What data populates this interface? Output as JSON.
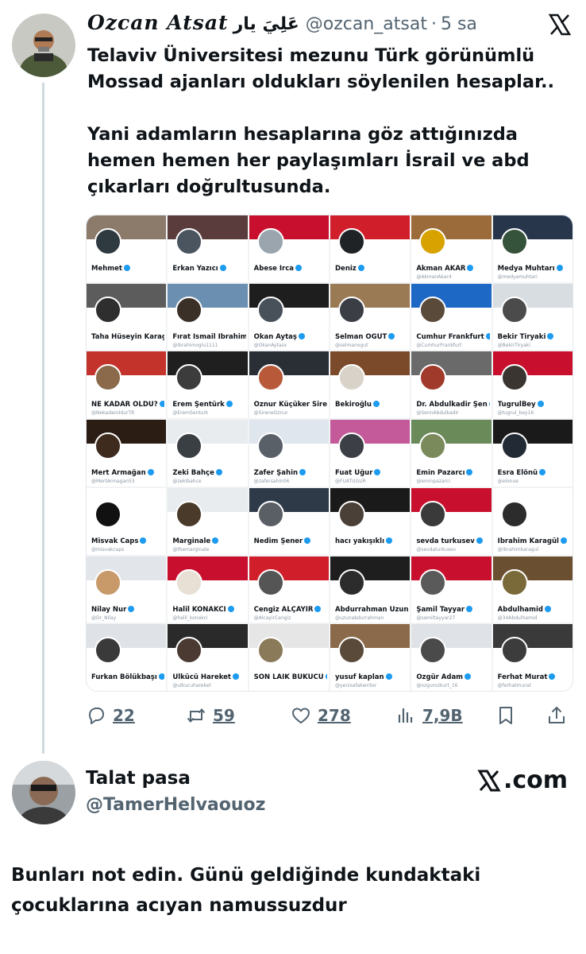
{
  "tweet": {
    "author_name": "Ozcan Atsat",
    "author_rtl": "عَلِيَ يار",
    "handle": "@ozcan_atsat",
    "dot": "·",
    "time": "5 sa",
    "text": "Telaviv Üniversitesi mezunu Türk görünümlü\nMossad ajanları oldukları söylenilen hesaplar..\n\nYani adamların hesaplarına göz attığınızda\nhemen hemen her paylaşımları İsrail ve abd\nçıkarları doğrultusunda.",
    "metrics": {
      "replies": "22",
      "reposts": "59",
      "likes": "278",
      "views": "7,9B"
    },
    "icons": [
      "x-logo-icon",
      "reply-icon",
      "repost-icon",
      "like-icon",
      "views-icon",
      "bookmark-icon",
      "share-icon"
    ]
  },
  "media_accounts": [
    {
      "name": "Mehmet",
      "handle": "",
      "banner": "#8c7a6b",
      "avatar": "#2f3a40"
    },
    {
      "name": "Erkan Yazıcı",
      "handle": "",
      "banner": "#5a3c3c",
      "avatar": "#4a5560"
    },
    {
      "name": "Abese İrca",
      "handle": "",
      "banner": "#c8102e",
      "avatar": "#9aa5ad"
    },
    {
      "name": "Deniz",
      "handle": "",
      "banner": "#d01e2a",
      "avatar": "#1f2326"
    },
    {
      "name": "Akman AKAR",
      "handle": "@AkmanAkar4",
      "banner": "#9c6b3a",
      "avatar": "#d8a200"
    },
    {
      "name": "Medya Muhtarı",
      "handle": "@medyamuhtari",
      "banner": "#27364a",
      "avatar": "#35523b"
    },
    {
      "name": "Taha Hüseyin Karagöz",
      "handle": "",
      "banner": "#5c5c5c",
      "avatar": "#2e2e2e"
    },
    {
      "name": "Fırat İsmail İbrahimoğlu",
      "handle": "@ibrahimoglu1111",
      "banner": "#6b8fb0",
      "avatar": "#3a3028"
    },
    {
      "name": "Okan Aytaş",
      "handle": "@OkanAytasx",
      "banner": "#1e1e1e",
      "avatar": "#48505a"
    },
    {
      "name": "Selman ÖĞÜT",
      "handle": "@selmanogut",
      "banner": "#9a7a55",
      "avatar": "#3b3f45"
    },
    {
      "name": "Cumhur Frankfurt",
      "handle": "@CumhurFrankfurt",
      "banner": "#1d68c4",
      "avatar": "#5a4a3a"
    },
    {
      "name": "Bekir Tiryaki",
      "handle": "@BekirTiryaki",
      "banner": "#d8dde2",
      "avatar": "#4b4b4b"
    },
    {
      "name": "NE KADAR OLDU?",
      "handle": "@NekadaroldurTR",
      "banner": "#c4332b",
      "avatar": "#8a6a4a"
    },
    {
      "name": "Erem Şentürk",
      "handle": "@EremSenturk",
      "banner": "#1f1f1f",
      "avatar": "#3c3c3c"
    },
    {
      "name": "Öznur Küçüker Sirene",
      "handle": "@SireneOznur",
      "banner": "#2a2f36",
      "avatar": "#b85a3a"
    },
    {
      "name": "Bekiroğlu",
      "handle": "",
      "banner": "#7a4a2a",
      "avatar": "#d9d2c8"
    },
    {
      "name": "Dr. Abdulkadir Şen",
      "handle": "@SennAbdulkadir",
      "banner": "#6a6a6a",
      "avatar": "#a03a2a"
    },
    {
      "name": "TugrulBey",
      "handle": "@tugrul_bey16",
      "banner": "#c8102e",
      "avatar": "#3a3530"
    },
    {
      "name": "Mert Armağan",
      "handle": "@MertArmagan53",
      "banner": "#2b1c14",
      "avatar": "#3e2b1e"
    },
    {
      "name": "Zeki Bahçe",
      "handle": "@zekibahce",
      "banner": "#e8ecef",
      "avatar": "#3a3f44"
    },
    {
      "name": "Zafer Şahin",
      "handle": "@zafersahin06",
      "banner": "#dfe6ee",
      "avatar": "#5a6068"
    },
    {
      "name": "Fuat Uğur",
      "handle": "@FUATUGUR",
      "banner": "#c45a9a",
      "avatar": "#3c3f45"
    },
    {
      "name": "Emin Pazarcı",
      "handle": "@eminpazarci",
      "banner": "#6b8a5a",
      "avatar": "#7a8a5a"
    },
    {
      "name": "Esra Elönü",
      "handle": "@elonue",
      "banner": "#1a1a1a",
      "avatar": "#222a35"
    },
    {
      "name": "Misvak Caps",
      "handle": "@misvakcaps",
      "banner": "#ffffff",
      "avatar": "#111111"
    },
    {
      "name": "Marginale",
      "handle": "@themarginale",
      "banner": "#e8ecef",
      "avatar": "#4a3a2a"
    },
    {
      "name": "Nedim Şener",
      "handle": "",
      "banner": "#2e3a48",
      "avatar": "#5a5f66"
    },
    {
      "name": "hacı yakışıklı",
      "handle": "",
      "banner": "#1a1a1a",
      "avatar": "#4a4038"
    },
    {
      "name": "sevda turkusev",
      "handle": "@sevdaturkusev",
      "banner": "#c8102e",
      "avatar": "#3a3a3a"
    },
    {
      "name": "İbrahim Karagül",
      "handle": "@ibrahimkaragul",
      "banner": "#ffffff",
      "avatar": "#2c2c2c"
    },
    {
      "name": "Nilay Nur",
      "handle": "@Dr_Nilay",
      "banner": "#e2e6ea",
      "avatar": "#c89a6a"
    },
    {
      "name": "Halil KONAKCI",
      "handle": "@halil_konakci",
      "banner": "#c8102e",
      "avatar": "#e8e0d5"
    },
    {
      "name": "Cengiz ALÇAYIR",
      "handle": "@AlcayirCengiz",
      "banner": "#d01e2a",
      "avatar": "#555555"
    },
    {
      "name": "Abdurrahman Uzun",
      "handle": "@uzunabdurrahman",
      "banner": "#1e1e1e",
      "avatar": "#2c2c2c"
    },
    {
      "name": "Şamil Tayyar",
      "handle": "@samiltayyar27",
      "banner": "#c8102e",
      "avatar": "#5a5a5a"
    },
    {
      "name": "Abdulhamid",
      "handle": "@34Abdulhamid",
      "banner": "#6a5030",
      "avatar": "#7a6a3a"
    },
    {
      "name": "Furkan Bölükbaşı",
      "handle": "",
      "banner": "#dfe3e7",
      "avatar": "#3a3a3a"
    },
    {
      "name": "Ülkücü Hareket",
      "handle": "@ulkucuhareket",
      "banner": "#2a2a2a",
      "avatar": "#4a3a32"
    },
    {
      "name": "SON LAİK BÜKÜCÜ",
      "handle": "",
      "banner": "#e6e6e6",
      "avatar": "#8a7a5a"
    },
    {
      "name": "yusuf kaplan",
      "handle": "@yenisafakwriter",
      "banner": "#8a6a4a",
      "avatar": "#5a4a3a"
    },
    {
      "name": "Özgür Adam",
      "handle": "@ozgurozkurt_16",
      "banner": "#dfe3e7",
      "avatar": "#4a4a4a"
    },
    {
      "name": "Ferhat Murat",
      "handle": "@ferhatmurat",
      "banner": "#3a3a3a",
      "avatar": "#3c3c3c"
    }
  ],
  "quoted": {
    "author_name": "Talat pasa",
    "handle": "@TamerHelvaouoz",
    "brand": ".com",
    "text": "Bunları not edin. Günü geldiğinde kundaktaki\nçocuklarına acıyan namussuzdur"
  },
  "colors": {
    "text": "#0f1419",
    "secondary": "#536471",
    "verified": "#1d9bf0",
    "thread_line": "#cfd9de"
  }
}
